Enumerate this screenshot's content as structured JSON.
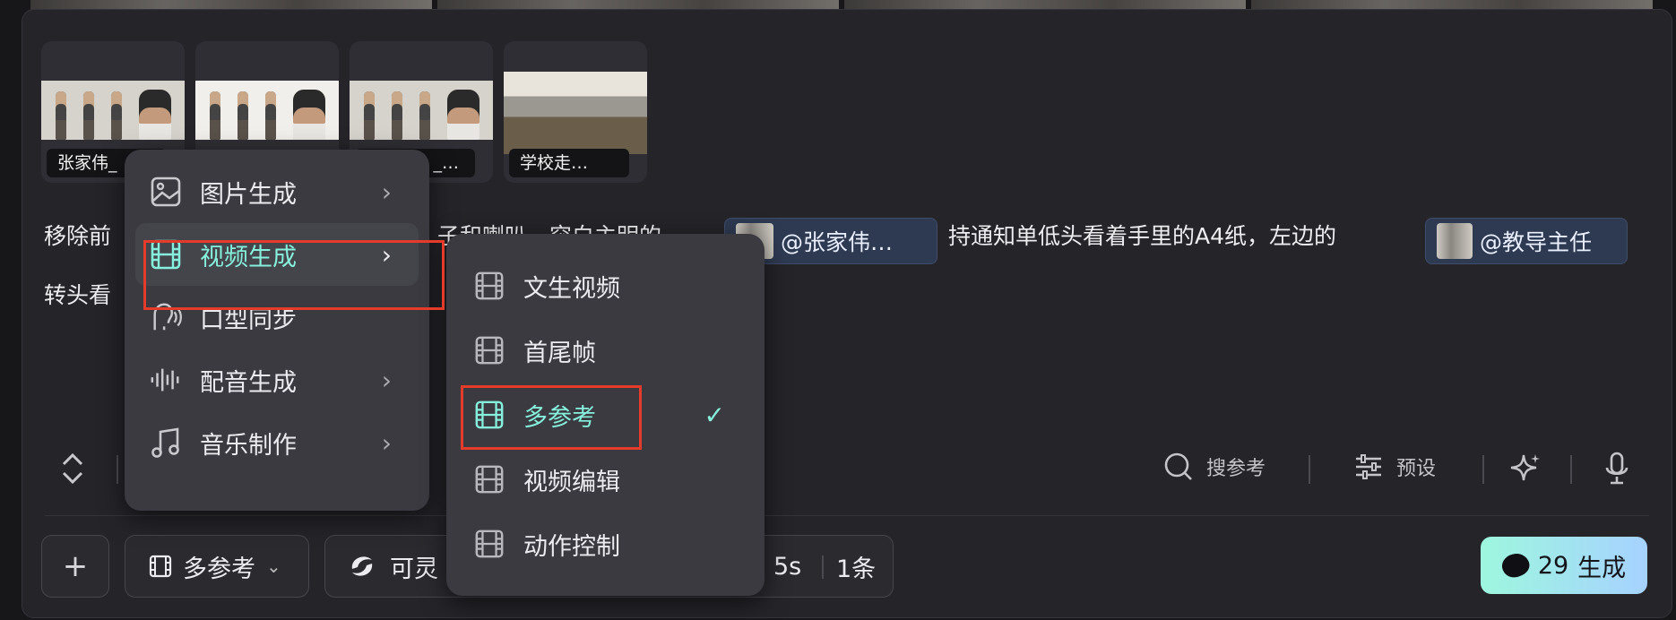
{
  "thumbnails": [
    {
      "caption": "张家伟_"
    },
    {
      "caption": ""
    },
    {
      "caption": "_…"
    },
    {
      "caption": "学校走…"
    }
  ],
  "prompt": {
    "line1_start": "移除前",
    "line1_mid": "子和喇叭，突白主明的",
    "chip1": "@张家伟…",
    "line1_after": "持通知单低头看着手里的A4纸，左边的",
    "chip2": "@教导主任",
    "line2_start": "转头看"
  },
  "menu_main": [
    {
      "label": "图片生成",
      "icon": "image-icon",
      "arrow": "›"
    },
    {
      "label": "视频生成",
      "icon": "film-icon",
      "arrow": "›",
      "active": true
    },
    {
      "label": "口型同步",
      "icon": "lip-sync-icon"
    },
    {
      "label": "配音生成",
      "icon": "audio-wave-icon",
      "arrow": "›"
    },
    {
      "label": "音乐制作",
      "icon": "music-note-icon",
      "arrow": "›"
    }
  ],
  "menu_sub": [
    {
      "label": "文生视频",
      "icon": "film-icon"
    },
    {
      "label": "首尾帧",
      "icon": "film-icon"
    },
    {
      "label": "多参考",
      "icon": "film-icon",
      "selected": true,
      "check": "✓"
    },
    {
      "label": "视频编辑",
      "icon": "film-icon"
    },
    {
      "label": "动作控制",
      "icon": "film-icon"
    }
  ],
  "tools": {
    "search_ref": "搜参考",
    "preset": "预设"
  },
  "bottom": {
    "add": "+",
    "mode": "多参考",
    "model": "可灵",
    "duration": "5s",
    "count": "1条",
    "generate_cost": "29",
    "generate_label": "生成"
  },
  "colors": {
    "accent": "#86f0dc",
    "highlight": "#e43b2b",
    "chip_bg": "#2e3a52"
  }
}
